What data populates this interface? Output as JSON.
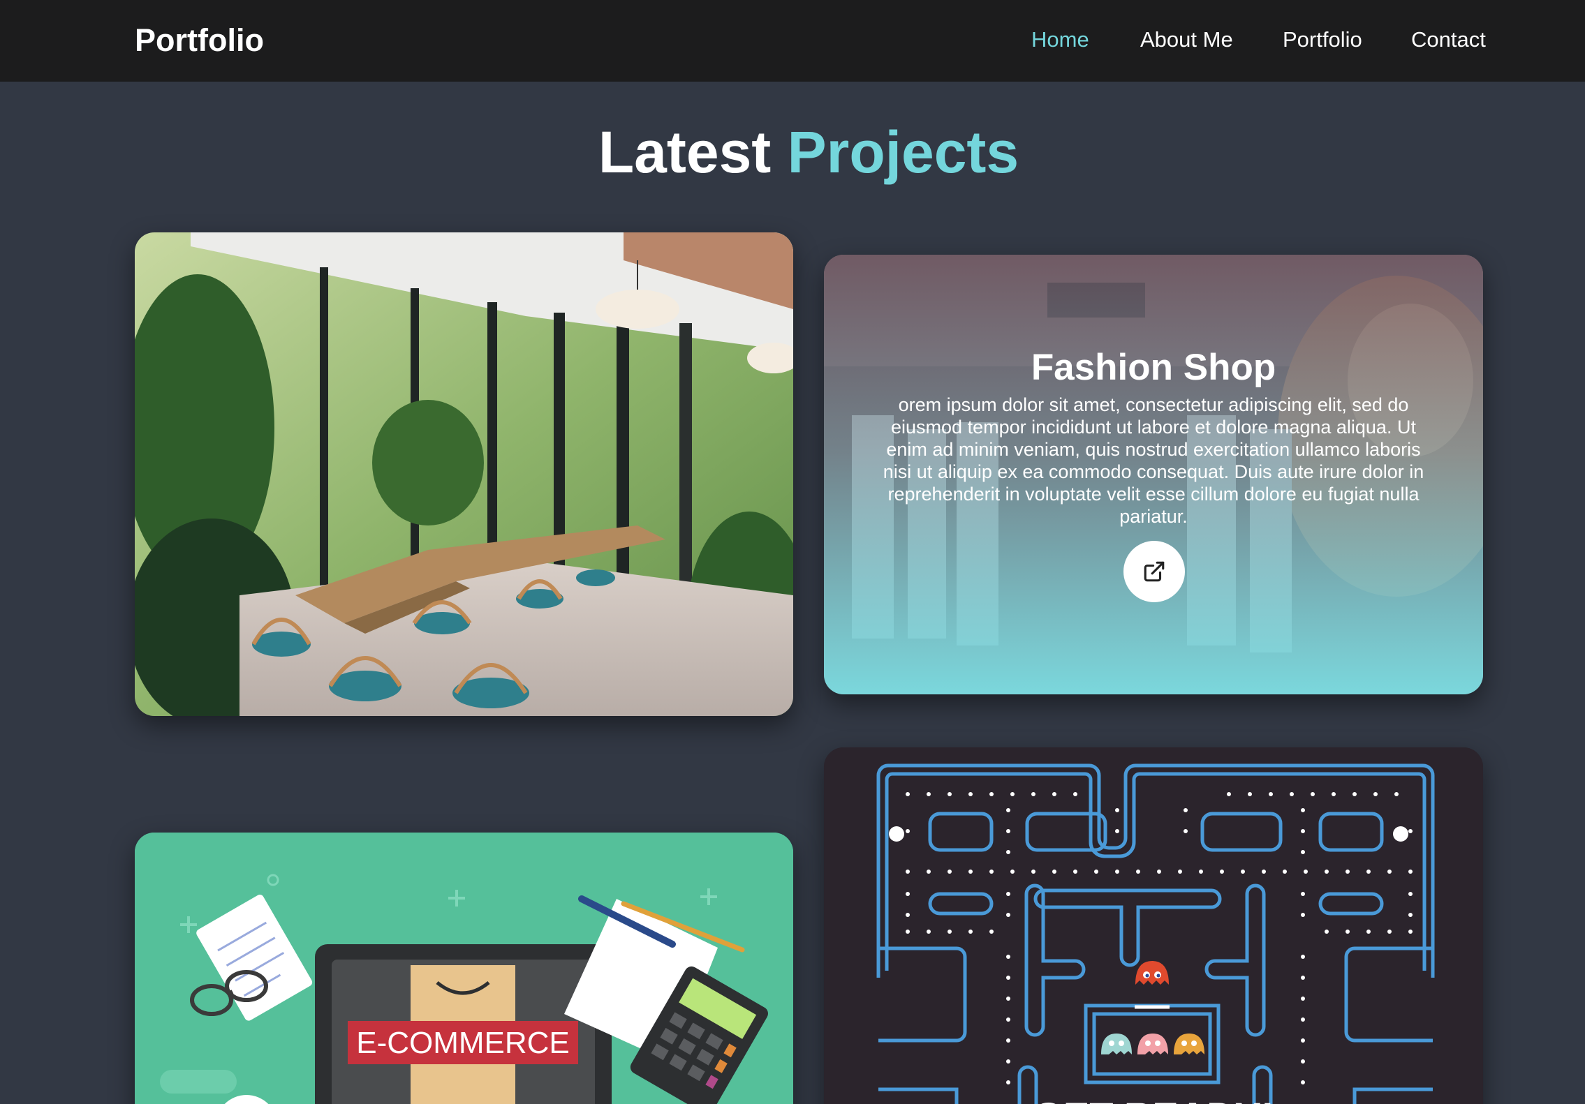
{
  "navbar": {
    "brand": "Portfolio",
    "items": [
      {
        "label": "Home",
        "active": true
      },
      {
        "label": "About Me",
        "active": false
      },
      {
        "label": "Portfolio",
        "active": false
      },
      {
        "label": "Contact",
        "active": false
      }
    ]
  },
  "section": {
    "title_part1": "Latest",
    "title_part2": "Projects"
  },
  "projects": [
    {
      "image": "restaurant-interior"
    },
    {
      "image": "fashion-shop",
      "title": "Fashion Shop",
      "description": "orem ipsum dolor sit amet, consectetur adipiscing elit, sed do eiusmod tempor incididunt ut labore et dolore magna aliqua. Ut enim ad minim veniam, quis nostrud exercitation ullamco laboris nisi ut aliquip ex ea commodo consequat. Duis aute irure dolor in reprehenderit in voluptate velit esse cillum dolore eu fugiat nulla pariatur.",
      "link_icon": "external-link-icon"
    },
    {
      "image": "ecommerce-illustration",
      "banner_text": "E-COMMERCE"
    },
    {
      "image": "pacman-maze",
      "banner_text": "GET READY!"
    }
  ],
  "colors": {
    "accent": "#74d6dc",
    "page_bg": "#323844",
    "navbar_bg": "#1c1c1d"
  }
}
